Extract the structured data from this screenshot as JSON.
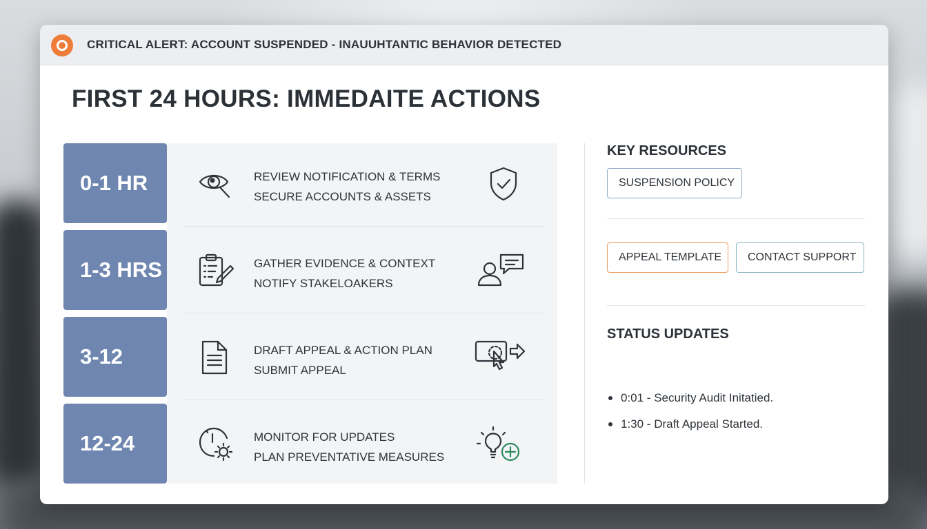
{
  "alert": {
    "text": "CRITICAL ALERT: ACCOUNT SUSPENDED - INAUUHTANTIC BEHAVIOR DETECTED",
    "icon": "alert-circle-icon",
    "color": "#ef7d3a"
  },
  "page_title": "FIRST 24 HOURS: IMMEDAITE ACTIONS",
  "timeline": [
    {
      "label": "0-1 HR",
      "line1": "REVIEW NOTIFICATION & TERMS",
      "line2": "SECURE ACCOUNTS & ASSETS",
      "left_icon": "eye-search-icon",
      "right_icon": "shield-check-icon"
    },
    {
      "label": "1-3 HRS",
      "line1": "GATHER EVIDENCE & CONTEXT",
      "line2": "NOTIFY STAKELOAKERS",
      "left_icon": "clipboard-edit-icon",
      "right_icon": "user-chat-icon"
    },
    {
      "label": "3-12",
      "line1": "DRAFT APPEAL & ACTION PLAN",
      "line2": "SUBMIT APPEAL",
      "left_icon": "document-icon",
      "right_icon": "click-submit-icon"
    },
    {
      "label": "12-24",
      "line1": "MONITOR FOR UPDATES",
      "line2": "PLAN PREVENTATIVE MEASURES",
      "left_icon": "clock-gear-icon",
      "right_icon": "lightbulb-plus-icon"
    }
  ],
  "key_resources": {
    "title": "KEY RESOURCES",
    "suspension_policy": "SUSPENSION POLICY",
    "appeal_template": "APPEAL TEMPLATE",
    "contact_support": "CONTACT SUPPORT"
  },
  "status_updates": {
    "title": "STATUS UPDATES",
    "items": [
      "0:01 - Security Audit Initatied.",
      "1:30 - Draft Appeal Started."
    ]
  },
  "colors": {
    "timeline_label_bg": "#6f87b0",
    "accent_orange": "#ef9a5a",
    "accent_teal": "#8cb6c2",
    "accent_blue": "#8fa8c4"
  }
}
